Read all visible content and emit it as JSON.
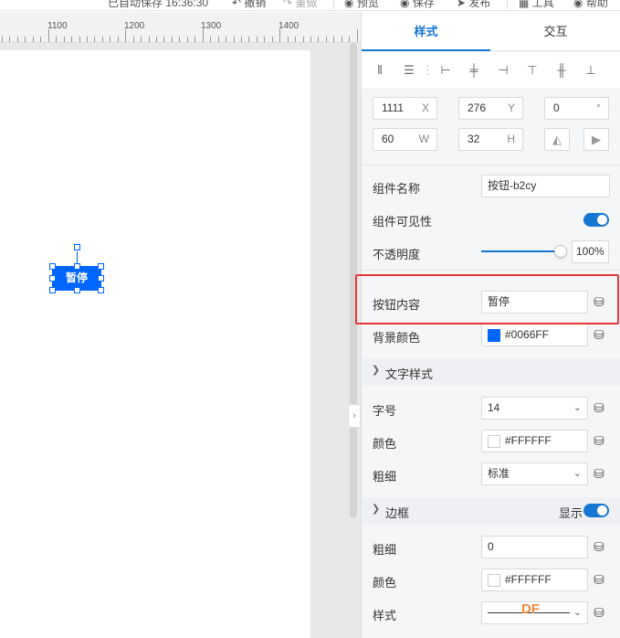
{
  "toolbar": {
    "autosave": "已自动保存 16:36:30",
    "undo": "撤销",
    "redo": "重做",
    "preview": "预览",
    "save": "保存",
    "publish": "发布",
    "tool": "工具",
    "help": "帮助"
  },
  "ruler": {
    "labels": [
      "1100",
      "1200",
      "1300",
      "1400"
    ]
  },
  "canvas": {
    "button_label": "暂停",
    "button_color": "#0066FF"
  },
  "tabs": {
    "style": "样式",
    "interaction": "交互"
  },
  "geometry": {
    "x": "1111",
    "x_unit": "X",
    "y": "276",
    "y_unit": "Y",
    "rotation": "0",
    "rotation_unit": "°",
    "w": "60",
    "w_unit": "W",
    "h": "32",
    "h_unit": "H"
  },
  "props": {
    "name_label": "组件名称",
    "name_value": "按钮-b2cy",
    "visible_label": "组件可见性",
    "opacity_label": "不透明度",
    "opacity_value": "100%",
    "content_label": "按钮内容",
    "content_value": "暂停",
    "bg_label": "背景颜色",
    "bg_value": "#0066FF"
  },
  "text_style": {
    "title": "文字样式",
    "size_label": "字号",
    "size_value": "14",
    "color_label": "颜色",
    "color_value": "#FFFFFF",
    "weight_label": "粗细",
    "weight_value": "标准"
  },
  "border": {
    "title": "边框",
    "show_label": "显示",
    "weight_label": "粗细",
    "weight_value": "0",
    "color_label": "颜色",
    "color_value": "#FFFFFF",
    "style_label": "样式"
  },
  "watermark": "DF"
}
